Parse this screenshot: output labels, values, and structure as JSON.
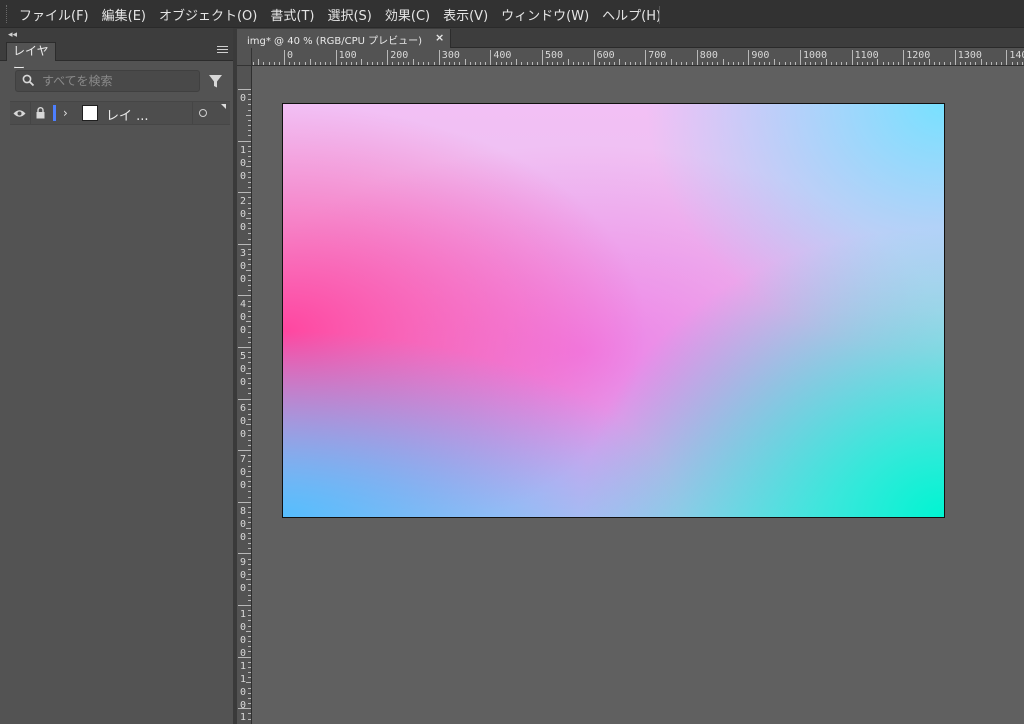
{
  "menu": {
    "items": [
      "ファイル(F)",
      "編集(E)",
      "オブジェクト(O)",
      "書式(T)",
      "選択(S)",
      "効果(C)",
      "表示(V)",
      "ウィンドウ(W)",
      "ヘルプ(H)"
    ]
  },
  "panel": {
    "tab_label": "レイヤー",
    "search_placeholder": "すべてを検索",
    "layer": {
      "name": "レイ ...",
      "color": "#4d7fff"
    }
  },
  "document": {
    "tab_label": "img* @ 40 % (RGB/CPU プレビュー)",
    "close_glyph": "×"
  },
  "rulers": {
    "horizontal": [
      "0",
      "100",
      "200",
      "300",
      "400",
      "500",
      "600",
      "700",
      "800",
      "900",
      "1000",
      "1100",
      "1200",
      "1300",
      "140"
    ],
    "vertical": [
      "0",
      "100",
      "200",
      "300",
      "400",
      "500",
      "600",
      "700",
      "800",
      "900",
      "1000",
      "1100",
      "120"
    ]
  },
  "colors": {
    "menubar": "#323232",
    "panel": "#535353",
    "canvas_background": "#606060",
    "artboard_gradient": [
      "#ff4aa0",
      "#f2c0f5",
      "#8fe6ff",
      "#00f5d2",
      "#50beff"
    ]
  }
}
